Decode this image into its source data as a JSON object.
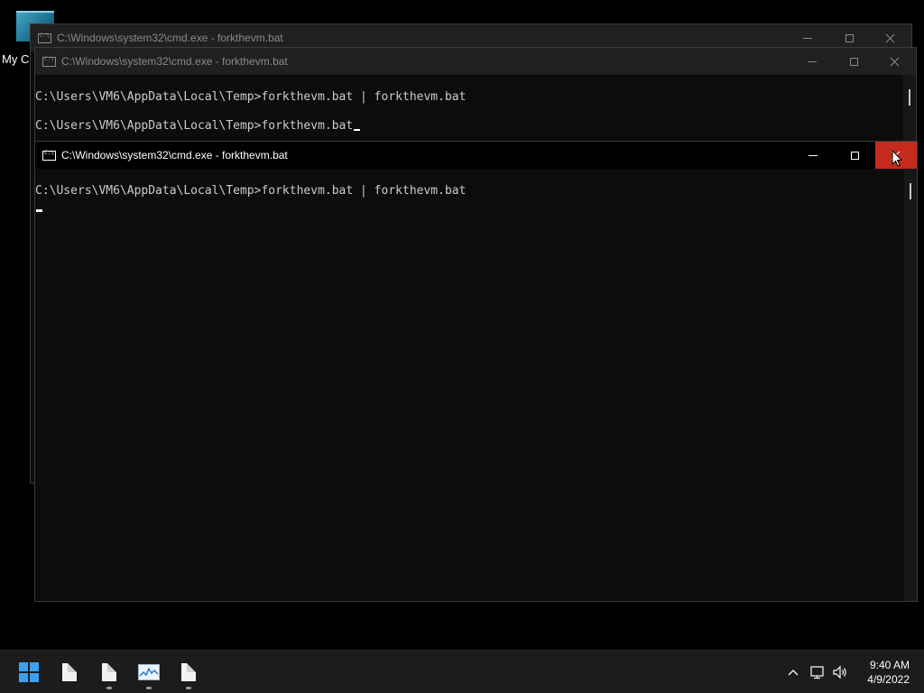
{
  "desktop": {
    "icon_label": "My C"
  },
  "windows": [
    {
      "title": "C:\\Windows\\system32\\cmd.exe - forkthevm.bat",
      "state": "inactive",
      "lines": []
    },
    {
      "title": "C:\\Windows\\system32\\cmd.exe - forkthevm.bat",
      "state": "inactive",
      "lines": [
        "C:\\Users\\VM6\\AppData\\Local\\Temp>forkthevm.bat | forkthevm.bat",
        "C:\\Users\\VM6\\AppData\\Local\\Temp>forkthevm.bat"
      ]
    },
    {
      "title": "C:\\Windows\\system32\\cmd.exe - forkthevm.bat",
      "state": "active",
      "lines": [
        "C:\\Users\\VM6\\AppData\\Local\\Temp>forkthevm.bat | forkthevm.bat"
      ]
    }
  ],
  "colors": {
    "close_hover": "#c42b1c",
    "console_bg": "#0c0c0c",
    "console_text": "#cccccc",
    "taskbar_bg": "#1c1c1c",
    "start_accent": "#3aa0f0"
  },
  "taskbar": {
    "start_icon": "windows-start-icon",
    "apps": [
      {
        "icon": "document-icon",
        "running": false
      },
      {
        "icon": "document-icon",
        "running": true
      },
      {
        "icon": "performance-monitor-icon",
        "running": true
      },
      {
        "icon": "document-icon",
        "running": true
      }
    ],
    "tray": {
      "chevron_icon": "chevron-up-icon",
      "network_icon": "network-icon",
      "volume_icon": "volume-icon"
    },
    "clock": {
      "time": "9:40 AM",
      "date": "4/9/2022"
    }
  }
}
